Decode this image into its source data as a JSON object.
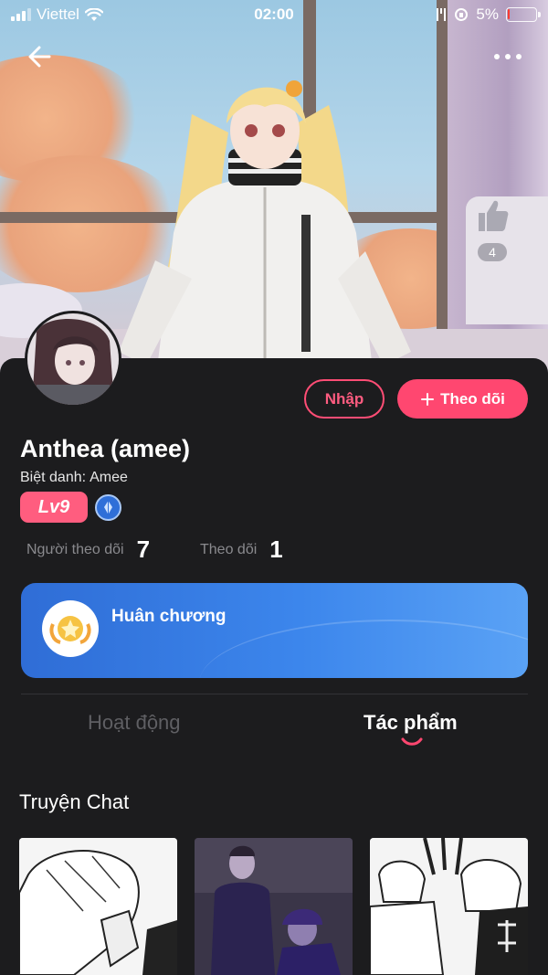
{
  "status_bar": {
    "carrier": "Viettel",
    "time": "02:00",
    "battery_percent": "5%",
    "battery_level": 0.05
  },
  "header": {
    "back_icon": "arrow-left-icon",
    "more_icon": "more-horizontal-icon"
  },
  "cover": {
    "like_icon": "thumbs-up-icon",
    "like_count": "4"
  },
  "profile": {
    "name": "Anthea (amee)",
    "nickname_label": "Biệt danh:",
    "nickname": "Amee",
    "level": "Lv9",
    "import_button": "Nhập",
    "follow_button": "Theo dõi",
    "follow_icon": "plus-icon",
    "followers_label": "Người theo dõi",
    "followers_count": "7",
    "following_label": "Theo dõi",
    "following_count": "1"
  },
  "medal_card": {
    "title": "Huân chương",
    "icon": "medal-icon"
  },
  "tabs": [
    {
      "label": "Hoạt động",
      "active": false
    },
    {
      "label": "Tác phẩm",
      "active": true
    }
  ],
  "section": {
    "title": "Truyện Chat"
  },
  "colors": {
    "accent": "#ff4770",
    "background": "#1c1c1e",
    "card_blue": "#3c86ec"
  }
}
